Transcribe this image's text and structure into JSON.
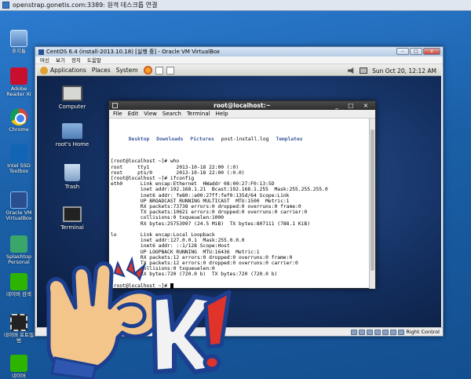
{
  "rdp": {
    "title": "openstrap.gonetis.com:3389: 원격 데스크톱 연결"
  },
  "win_desktop": {
    "icons": [
      {
        "name": "recycle-bin",
        "label": "휴지통"
      },
      {
        "name": "adobe-reader",
        "label": "Adobe Reader XI"
      },
      {
        "name": "chrome",
        "label": "Chrome"
      },
      {
        "name": "intel-ssd",
        "label": "Intel SSD Toolbox"
      },
      {
        "name": "oracle-vm",
        "label": "Oracle VM VirtualBox"
      },
      {
        "name": "splashtop",
        "label": "Splashtop Personal"
      },
      {
        "name": "naver-search",
        "label": "네이버 검색"
      },
      {
        "name": "naver-movie",
        "label": "네이버 포토앨범"
      },
      {
        "name": "naver-bottom",
        "label": "네이버"
      }
    ]
  },
  "vbox": {
    "title": "CentOS 6.4 (install-2013.10.18) [실행 중] - Oracle VM VirtualBox",
    "menu": [
      "머신",
      "보기",
      "장치",
      "도움말"
    ],
    "status_right": "Right Control"
  },
  "gnome": {
    "panel": {
      "applications": "Applications",
      "places": "Places",
      "system": "System",
      "clock": "Sun Oct 20, 12:12 AM"
    },
    "desktop_icons": [
      {
        "label": "Computer"
      },
      {
        "label": "root's Home"
      },
      {
        "label": "Trash"
      },
      {
        "label": "Terminal"
      }
    ]
  },
  "terminal": {
    "title": "root@localhost:~",
    "menu": [
      "File",
      "Edit",
      "View",
      "Search",
      "Terminal",
      "Help"
    ],
    "ls_row": [
      {
        "text": "Desktop",
        "dir": true
      },
      {
        "text": "Downloads",
        "dir": true
      },
      {
        "text": "Pictures",
        "dir": true
      },
      {
        "text": "post-install.log",
        "dir": false
      },
      {
        "text": "Templates",
        "dir": true
      }
    ],
    "lines": [
      "[root@localhost ~]# who",
      "root     tty1         2013-10-18 22:00 (:0)",
      "root     pts/0        2013-10-18 22:00 (:0.0)",
      "[root@localhost ~]# ifconfig",
      "eth0      Link encap:Ethernet  HWaddr 08:00:27:F0:13:5D",
      "          inet addr:192.168.1.21  Bcast:192.168.1.255  Mask:255.255.255.0",
      "          inet6 addr: fe80::a00:27ff:fef0:135d/64 Scope:Link",
      "          UP BROADCAST RUNNING MULTICAST  MTU:1500  Metric:1",
      "          RX packets:73738 errors:0 dropped:0 overruns:0 frame:0",
      "          TX packets:10621 errors:0 dropped:0 overruns:0 carrier:0",
      "          collisions:0 txqueuelen:1000",
      "          RX bytes:25753997 (24.5 MiB)  TX bytes:807111 (788.1 KiB)",
      "",
      "lo        Link encap:Local Loopback",
      "          inet addr:127.0.0.1  Mask:255.0.0.0",
      "          inet6 addr: ::1/128 Scope:Host",
      "          UP LOOPBACK RUNNING  MTU:16436  Metric:1",
      "          RX packets:12 errors:0 dropped:0 overruns:0 frame:0",
      "          TX packets:12 errors:0 dropped:0 overruns:0 carrier:0",
      "          collisions:0 txqueuelen:0",
      "          RX bytes:720 (720.0 b)  TX bytes:720 (720.0 b)",
      "",
      "[root@localhost ~]# "
    ]
  },
  "sticker": {
    "text_k": "K",
    "text_bang": "!"
  },
  "colors": {
    "sticker_outline": "#1d3f8f",
    "sticker_fill": "#f4c58a",
    "accent_red": "#e0342b"
  }
}
